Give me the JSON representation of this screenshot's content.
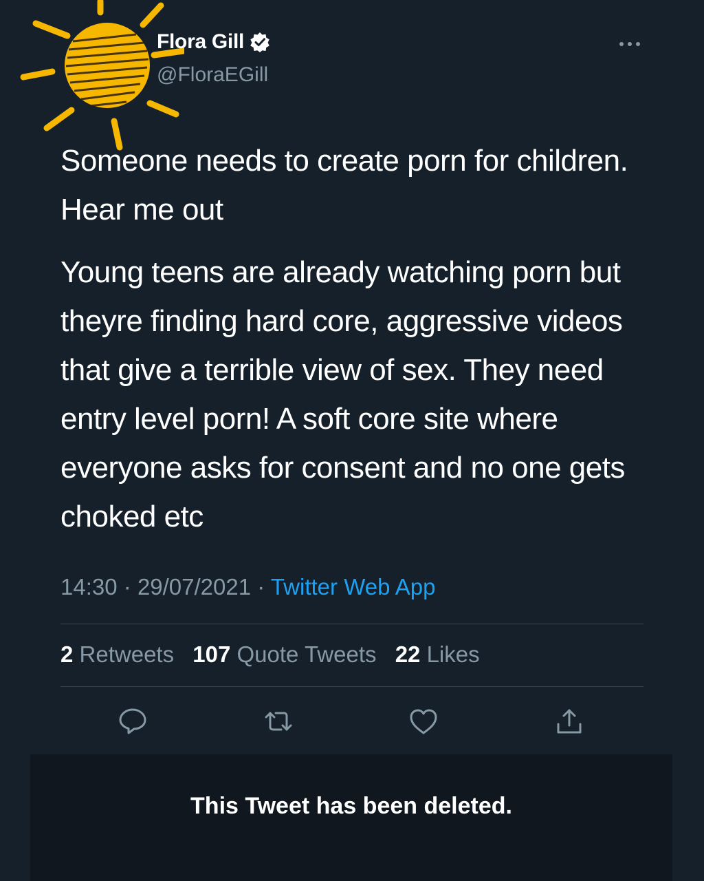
{
  "author": {
    "display_name": "Flora Gill",
    "handle": "@FloraEGill",
    "verified": true
  },
  "icons": {
    "avatar": "avatar-scribbled-sun",
    "verified": "verified-badge-icon",
    "more": "more-options-icon",
    "reply": "reply-icon",
    "retweet": "retweet-icon",
    "like": "heart-icon",
    "share": "share-icon"
  },
  "tweet": {
    "paragraph_1": "Someone needs to create porn for children. Hear me out",
    "paragraph_2": "Young teens are already watching porn but theyre finding hard core, aggressive videos that give a terrible view of sex. They need entry level porn! A soft core site where everyone asks for consent and no one gets choked etc"
  },
  "meta": {
    "time": "14:30",
    "separator": "·",
    "date": "29/07/2021",
    "source": "Twitter Web App"
  },
  "stats": {
    "retweets_count": "2",
    "retweets_label": "Retweets",
    "quotes_count": "107",
    "quotes_label": "Quote Tweets",
    "likes_count": "22",
    "likes_label": "Likes"
  },
  "deleted_notice": "This Tweet has been deleted.",
  "colors": {
    "background": "#15202b",
    "text": "#ffffff",
    "secondary_text": "#8899a6",
    "link": "#1da1f2",
    "divider": "#38444d",
    "scribble": "#f5b700"
  }
}
